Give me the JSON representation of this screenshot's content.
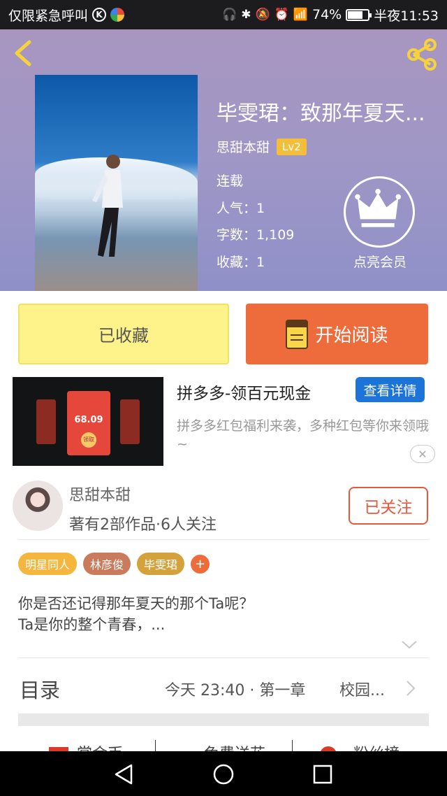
{
  "status_bar": {
    "left_text": "仅限紧急呼叫",
    "k_badge": "K",
    "battery": "74%",
    "battery_level": 0.74,
    "time": "半夜11:53"
  },
  "book": {
    "title": "毕雯珺：致那年夏天...",
    "author": "思甜本甜",
    "level": "Lv2",
    "status": "连载",
    "popularity": "人气：1",
    "word_count": "字数：1,109",
    "favorites": "收藏：1"
  },
  "vip": {
    "label": "点亮会员"
  },
  "actions": {
    "collected_label": "已收藏",
    "read_label": "开始阅读"
  },
  "ad": {
    "title": "拼多多-领百元现金",
    "detail_button": "查看详情",
    "description": "拼多多红包福利来袭，多种红包等你来领哦~",
    "card_amount": "68.09",
    "card_claim": "领取",
    "close_glyph": "✕"
  },
  "author_section": {
    "name": "思甜本甜",
    "meta": "著有2部作品·6人关注",
    "follow_label": "已关注"
  },
  "tags": [
    {
      "label": "明星同人",
      "color": "#f4b63c"
    },
    {
      "label": "林彦俊",
      "color": "#c97b5b"
    },
    {
      "label": "毕雯珺",
      "color": "#d4a23c"
    }
  ],
  "tag_add": "+",
  "description": {
    "line1": "你是否还记得那年夏天的那个Ta呢？",
    "line2": "Ta是你的整个青春，..."
  },
  "toc": {
    "label": "目录",
    "time_chapter": "今天 23:40 · 第一章",
    "chapter_title": "校园..."
  },
  "bottom_row": {
    "item1": "赏金币",
    "item2": "免费送花",
    "item3": "粉丝榜"
  },
  "colors": {
    "accent_orange": "#ee6c3c",
    "collect_yellow": "#fef38a",
    "detail_blue": "#1c74d9",
    "lv_gold": "#f4be3a"
  }
}
